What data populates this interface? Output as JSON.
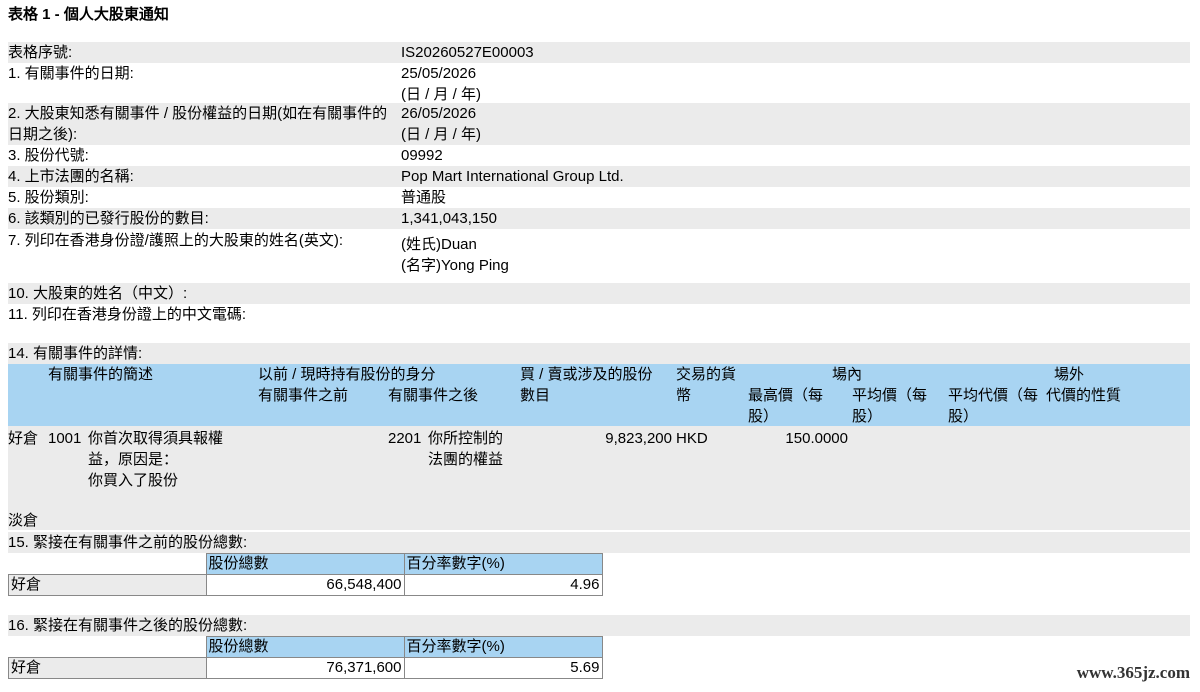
{
  "title": "表格 1 - 個人大股東通知",
  "fields": [
    {
      "label": "表格序號:",
      "value": [
        "IS20260527E00003"
      ]
    },
    {
      "label": "1. 有關事件的日期:",
      "value": [
        "25/05/2026",
        "(日 / 月 / 年)"
      ]
    },
    {
      "label": "2. 大股東知悉有關事件 / 股份權益的日期(如在有關事件的日期之後):",
      "value": [
        "26/05/2026",
        "(日 / 月 / 年)"
      ]
    },
    {
      "label": "3. 股份代號:",
      "value": [
        "09992"
      ]
    },
    {
      "label": "4. 上市法團的名稱:",
      "value": [
        "Pop Mart International Group Ltd."
      ]
    },
    {
      "label": "5. 股份類別:",
      "value": [
        "普通股"
      ]
    },
    {
      "label": "6. 該類別的已發行股份的數目:",
      "value": [
        "1,341,043,150"
      ]
    },
    {
      "label": "7. 列印在香港身份證/護照上的大股東的姓名(英文):",
      "value": [
        "(姓氏)Duan",
        "(名字)Yong Ping"
      ]
    }
  ],
  "field10": {
    "label": "10. 大股東的姓名（中文）:"
  },
  "field11": {
    "label": "11. 列印在香港身份證上的中文電碼:"
  },
  "field14": {
    "label": "14. 有關事件的詳情:"
  },
  "event_table": {
    "headers": {
      "desc": "有關事件的簡述",
      "capacity": "以前 / 現時持有股份的身分",
      "before": "有關事件之前",
      "after": "有關事件之後",
      "shares": [
        "買 / 賣或涉及的股份",
        "數目"
      ],
      "currency": [
        "交易的貨",
        "幣"
      ],
      "onex": "場內",
      "high": [
        "最高價（每",
        "股）"
      ],
      "avg": [
        "平均價（每",
        "股）"
      ],
      "offex": "場外",
      "avg_cons": [
        "平均代價（每",
        "股）"
      ],
      "nature": "代價的性質"
    },
    "long_label": "好倉",
    "short_label": "淡倉",
    "row": {
      "code": "1001",
      "desc": [
        "你首次取得須具報權",
        "益，原因是：",
        "你買入了股份"
      ],
      "code_after": "2201",
      "after": [
        "你所控制的",
        "法團的權益"
      ],
      "shares": "9,823,200",
      "currency": "HKD",
      "high": "150.0000"
    }
  },
  "section15": {
    "label": "15. 緊接在有關事件之前的股份總數:",
    "col_shares": "股份總數",
    "col_pct": "百分率數字(%)",
    "row_label": "好倉",
    "shares": "66,548,400",
    "pct": "4.96"
  },
  "section16": {
    "label": "16. 緊接在有關事件之後的股份總數:",
    "col_shares": "股份總數",
    "col_pct": "百分率數字(%)",
    "row_label": "好倉",
    "shares": "76,371,600",
    "pct": "5.69"
  },
  "watermark": "www.365jz.com"
}
